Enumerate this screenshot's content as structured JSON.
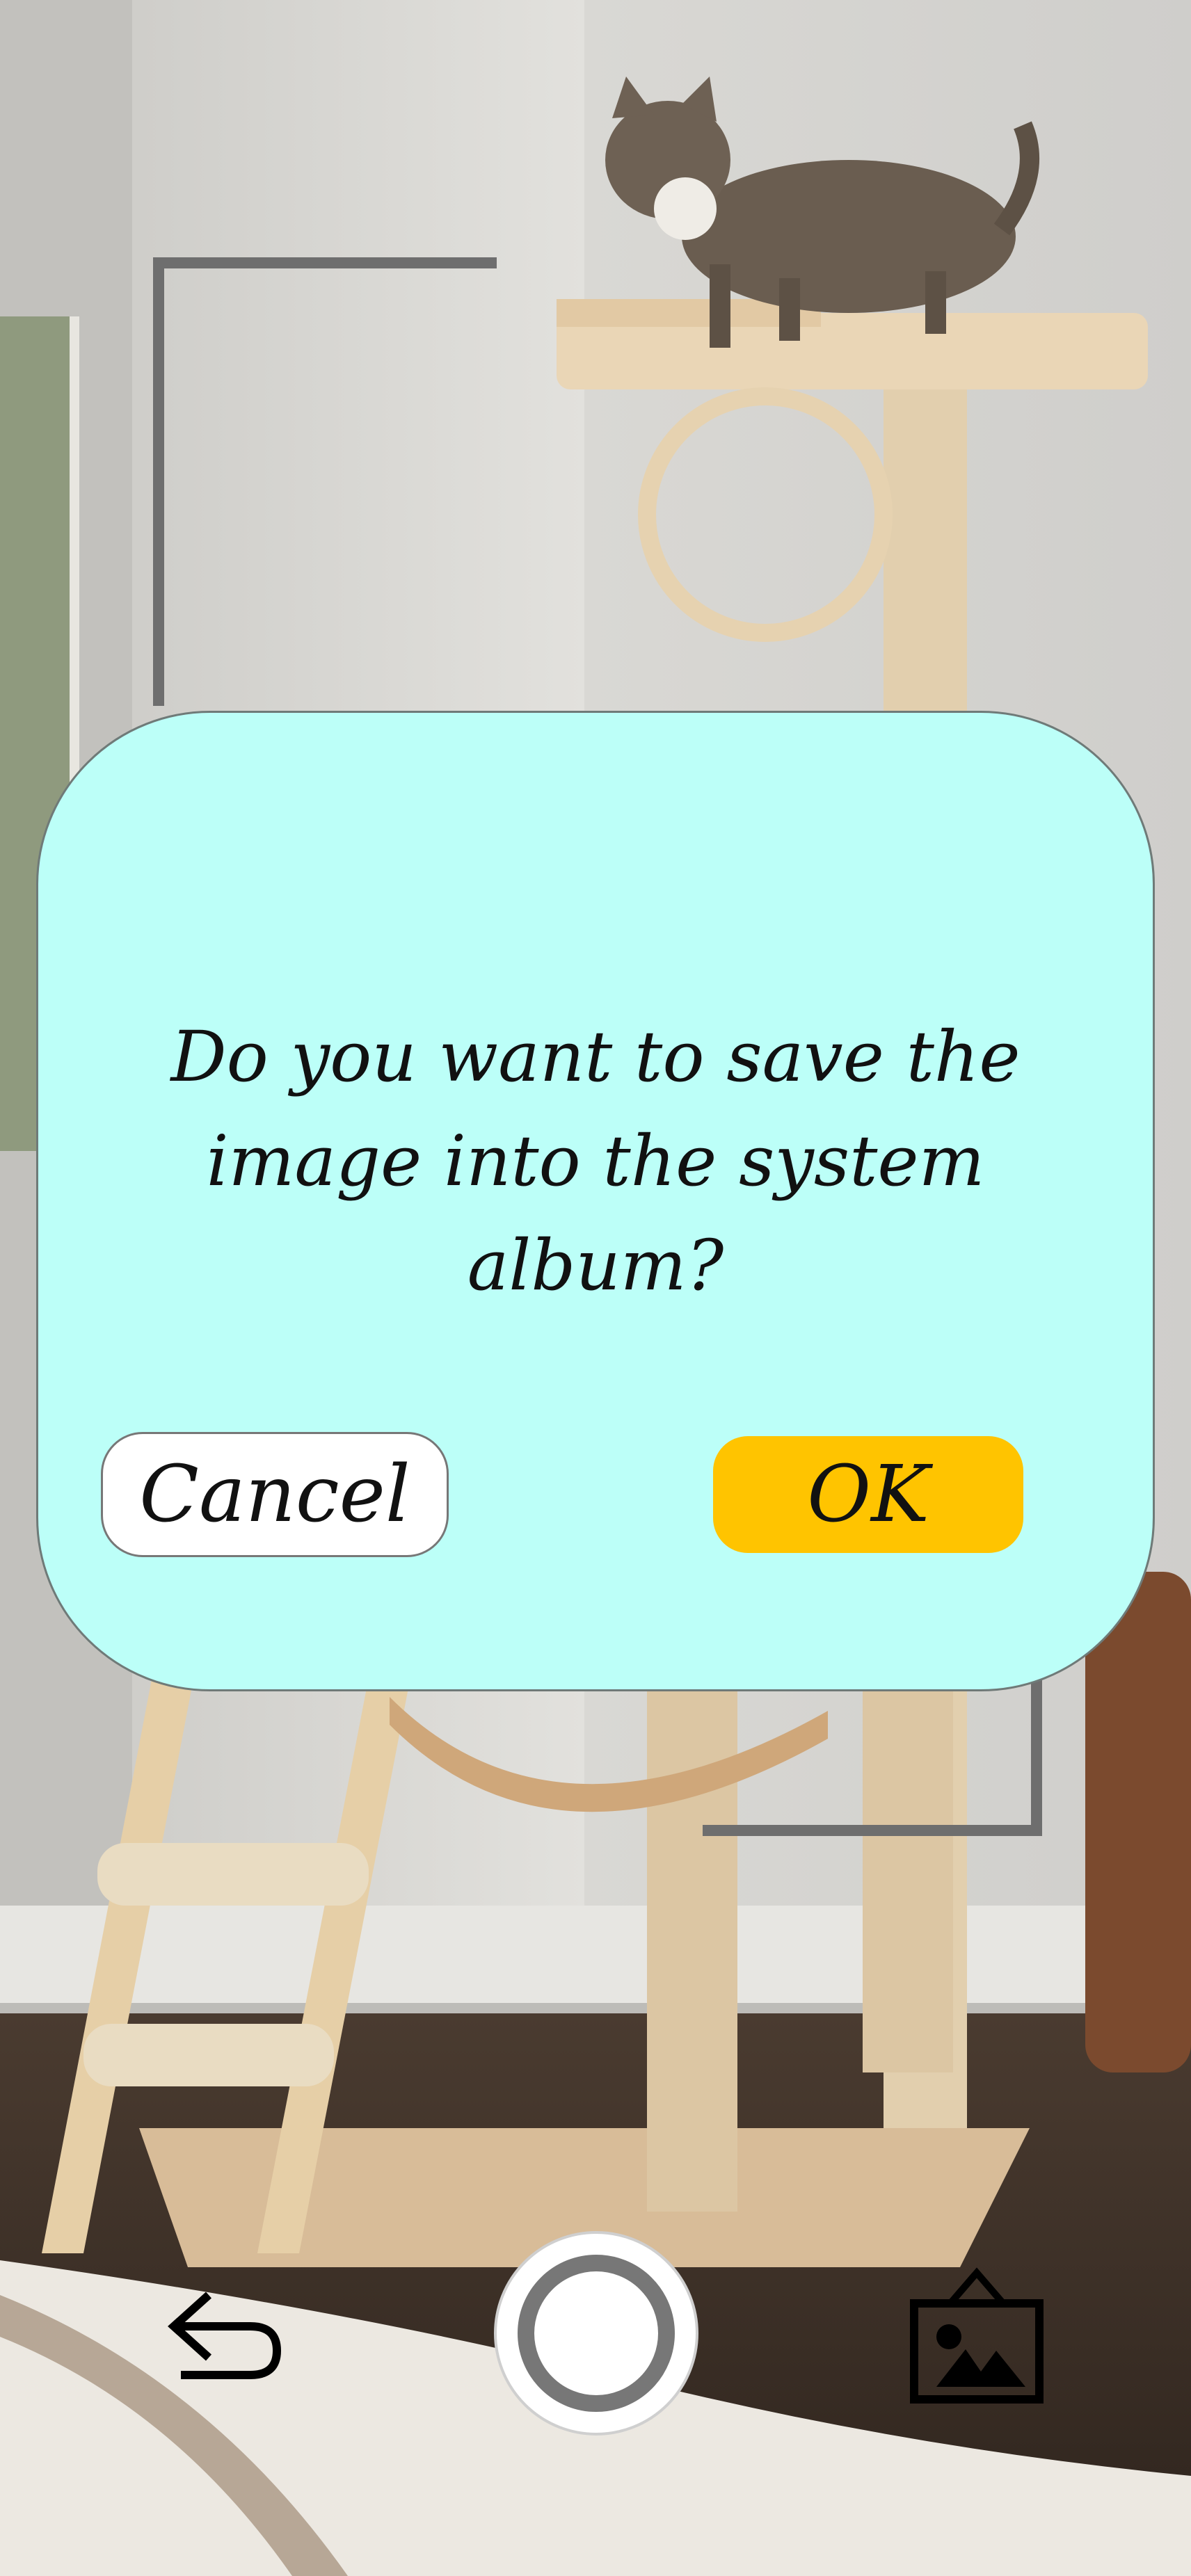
{
  "background": {
    "description_icon": "camera-viewfinder-photo-icon"
  },
  "dialog": {
    "message": "Do you want to save the image into the system album?",
    "cancel_label": "Cancel",
    "ok_label": "OK",
    "colors": {
      "background": "#bcfff8",
      "ok": "#ffc400",
      "cancel": "#ffffff"
    }
  },
  "toolbar": {
    "back_icon": "back-arrow-icon",
    "shutter_icon": "shutter-button-icon",
    "gallery_icon": "gallery-icon"
  }
}
